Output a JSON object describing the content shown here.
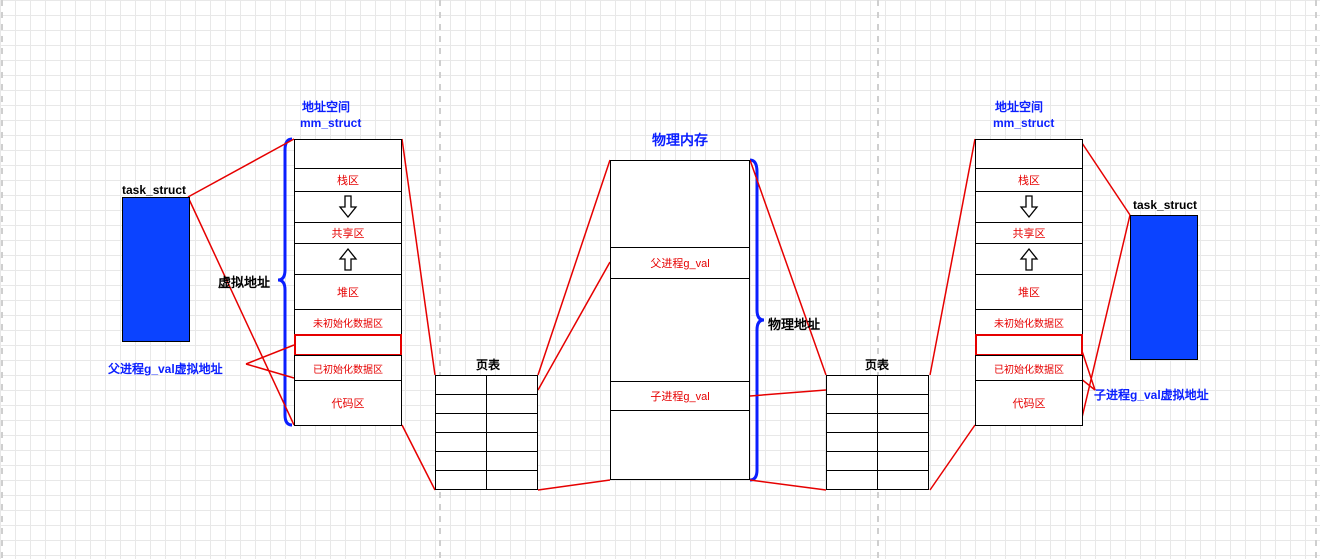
{
  "titles": {
    "addr_space_left": "地址空间",
    "mm_struct_left": "mm_struct",
    "addr_space_right": "地址空间",
    "mm_struct_right": "mm_struct",
    "physical_memory": "物理内存",
    "task_struct_left": "task_struct",
    "task_struct_right": "task_struct",
    "virtual_address": "虚拟地址",
    "physical_address": "物理地址",
    "page_table_left": "页表",
    "page_table_right": "页表",
    "parent_gval_vaddr": "父进程g_val虚拟地址",
    "child_gval_vaddr": "子进程g_val虚拟地址"
  },
  "mm_segments": {
    "stack": "栈区",
    "shared": "共享区",
    "heap": "堆区",
    "bss": "未初始化数据区",
    "data": "已初始化数据区",
    "code": "代码区"
  },
  "phys": {
    "parent_gval": "父进程g_val",
    "child_gval": "子进程g_val"
  }
}
